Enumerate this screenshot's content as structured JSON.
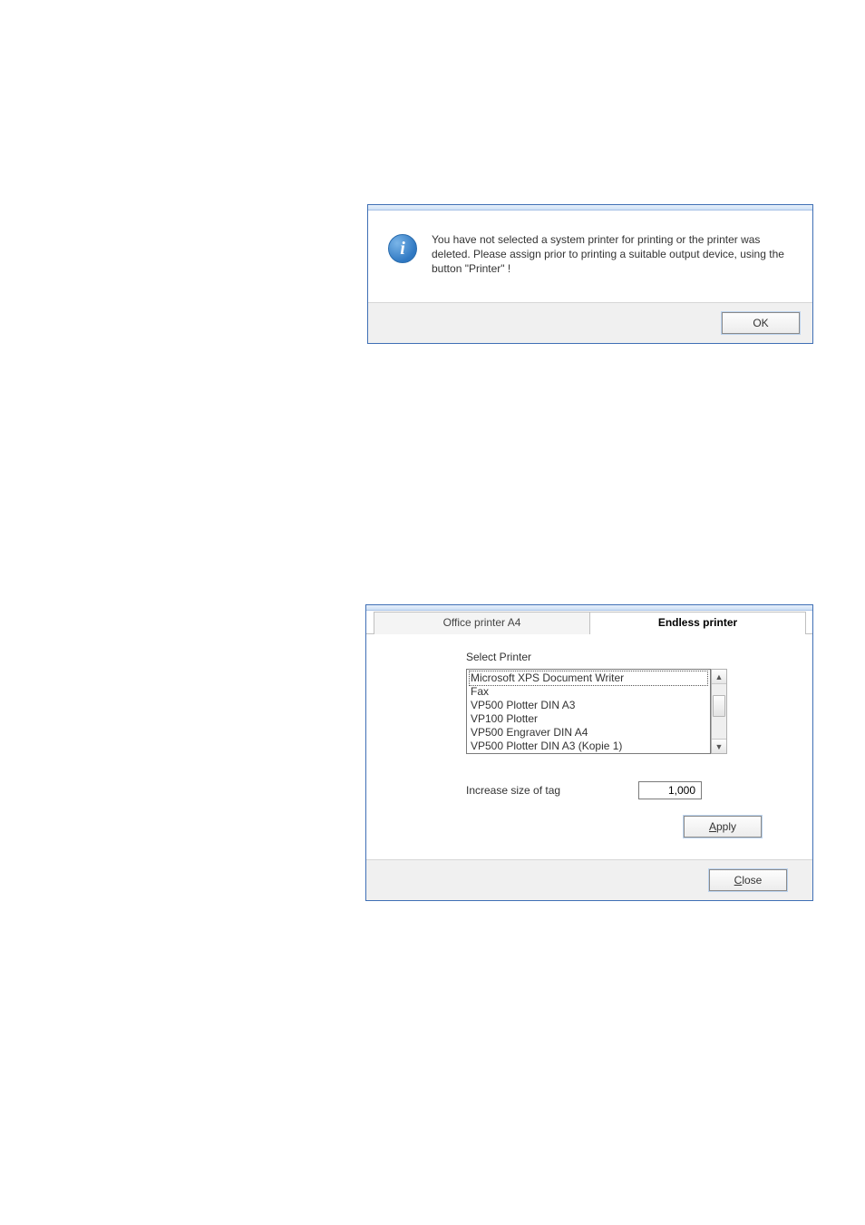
{
  "info_dialog": {
    "icon_char": "i",
    "message": "You have not selected a system printer for printing or the printer was deleted. Please assign prior to printing a suitable output device, using the button \"Printer\" !",
    "ok_label": "OK"
  },
  "printer_dialog": {
    "tabs": {
      "office": "Office printer A4",
      "endless": "Endless printer"
    },
    "select_printer_label": "Select Printer",
    "printer_options": [
      "Microsoft XPS Document Writer",
      "Fax",
      "VP500 Plotter DIN A3",
      "VP100 Plotter",
      "VP500 Engraver DIN A4",
      "VP500 Plotter DIN A3 (Kopie 1)"
    ],
    "increase_label": "Increase size of tag",
    "increase_value": "1,000",
    "apply_label_pre": "A",
    "apply_label_rest": "pply",
    "close_label_pre": "C",
    "close_label_rest": "lose"
  }
}
